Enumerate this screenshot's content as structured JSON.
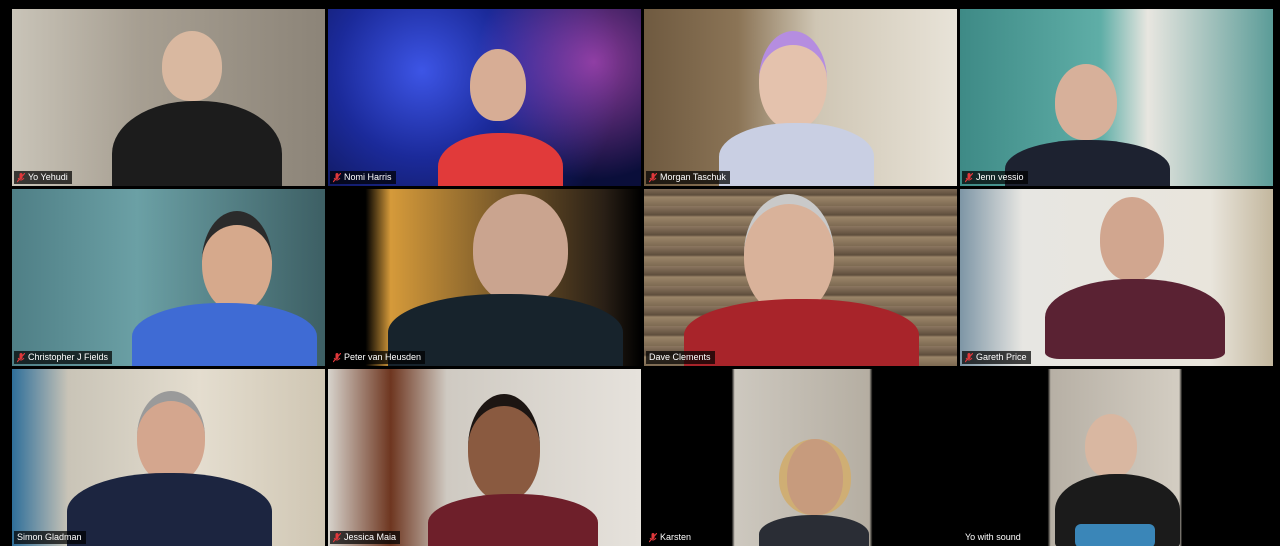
{
  "meeting": {
    "participants": [
      {
        "name": "Yo Yehudi",
        "muted": true,
        "active": false
      },
      {
        "name": "Nomi Harris",
        "muted": true,
        "active": false
      },
      {
        "name": "Morgan Taschuk",
        "muted": true,
        "active": true
      },
      {
        "name": "Jenn vessio",
        "muted": true,
        "active": false
      },
      {
        "name": "Christopher J Fields",
        "muted": true,
        "active": false
      },
      {
        "name": "Peter van Heusden",
        "muted": true,
        "active": false
      },
      {
        "name": "Dave Clements",
        "muted": false,
        "active": false
      },
      {
        "name": "Gareth Price",
        "muted": true,
        "active": false
      },
      {
        "name": "Simon Gladman",
        "muted": false,
        "active": false
      },
      {
        "name": "Jessica Maia",
        "muted": true,
        "active": false
      },
      {
        "name": "Karsten",
        "muted": true,
        "active": false
      },
      {
        "name": "Yo with sound",
        "muted": false,
        "active": false
      }
    ]
  },
  "colors": {
    "active_border": "#dfe34a",
    "muted_icon": "#e0383b",
    "label_bg": "#000000"
  }
}
